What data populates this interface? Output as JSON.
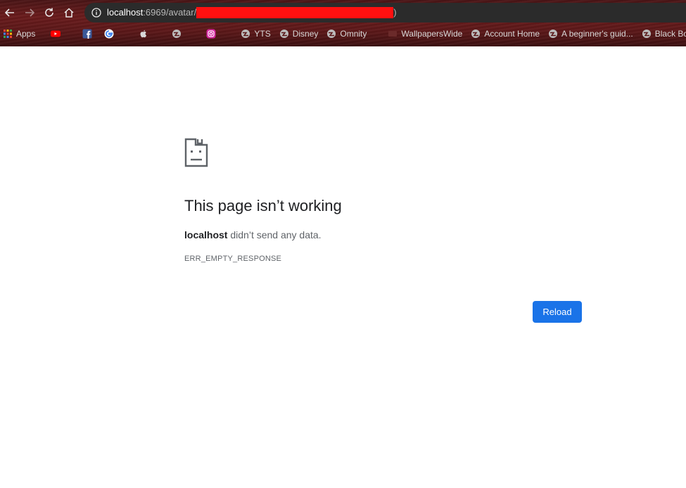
{
  "address_bar": {
    "host": "localhost",
    "path": ":6969/avatar/",
    "tail": ")"
  },
  "bookmarks": [
    {
      "label": "Apps",
      "icon": "apps-grid-icon"
    },
    {
      "label": "",
      "icon": "youtube-icon"
    },
    {
      "label": "",
      "icon": "facebook-icon"
    },
    {
      "label": "",
      "icon": "google-icon"
    },
    {
      "label": "",
      "icon": "apple-icon"
    },
    {
      "label": "",
      "icon": "globe-icon"
    },
    {
      "label": "",
      "icon": "instagram-icon"
    },
    {
      "label": "YTS",
      "icon": "globe-icon"
    },
    {
      "label": "Disney",
      "icon": "globe-icon"
    },
    {
      "label": "Omnity",
      "icon": "globe-icon"
    },
    {
      "label": "WallpapersWide",
      "icon": "wallpaperswide-icon"
    },
    {
      "label": "Account Home",
      "icon": "globe-icon"
    },
    {
      "label": "A beginner's guid...",
      "icon": "globe-icon"
    },
    {
      "label": "Black Bo",
      "icon": "globe-icon"
    }
  ],
  "error": {
    "title": "This page isn’t working",
    "host_bold": "localhost",
    "message": " didn’t send any data.",
    "code": "ERR_EMPTY_RESPONSE",
    "reload_label": "Reload"
  },
  "colors": {
    "accent": "#1a73e8",
    "redaction": "#ff1010",
    "title_text": "#202124",
    "secondary_text": "#5f6368"
  }
}
